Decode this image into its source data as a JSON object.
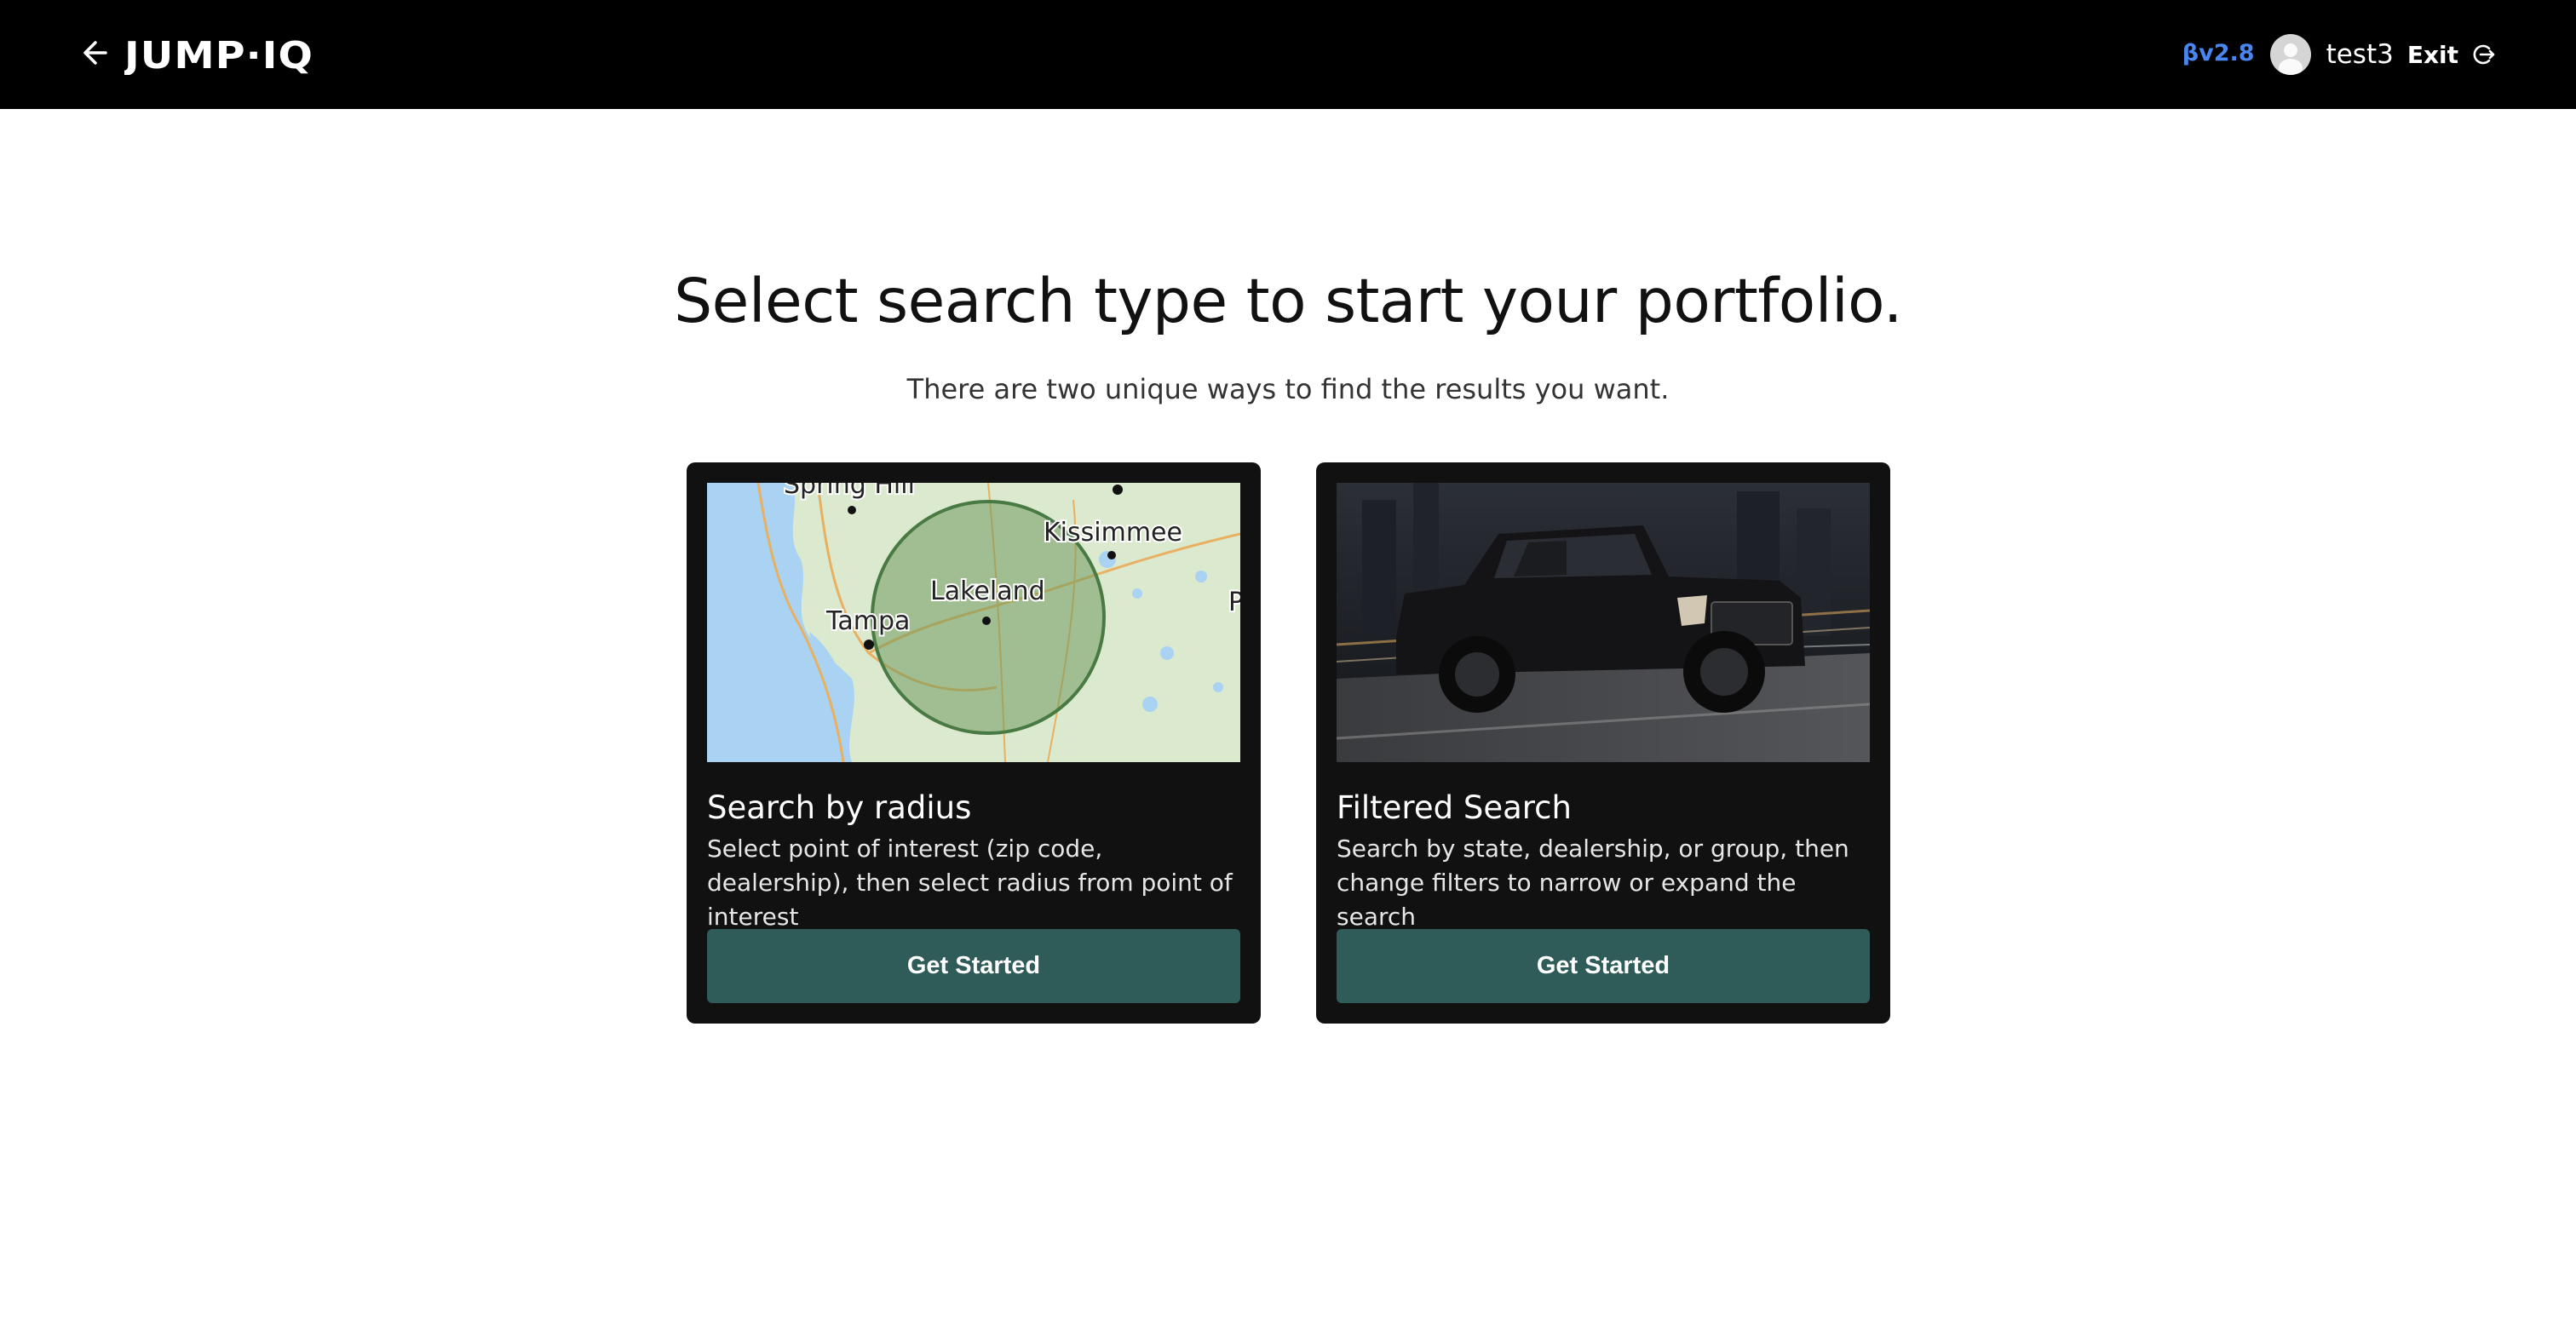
{
  "header": {
    "logo_text": "JUMP·IQ",
    "version": "βv2.8",
    "username": "test3",
    "exit_label": "Exit",
    "icons": {
      "back": "arrow-left-icon",
      "avatar": "user-avatar-icon",
      "exit": "logout-icon"
    }
  },
  "main": {
    "heading": "Select search type to start your portfolio.",
    "subheading": "There are two unique ways to find the results you want."
  },
  "cards": [
    {
      "title": "Search by radius",
      "description": "Select point of interest (zip code, dealership), then select radius from point of interest",
      "button_label": "Get Started",
      "image": "map-radius-illustration",
      "map_labels": {
        "spring_hill": "Spring Hill",
        "kissimmee": "Kissimmee",
        "lakeland": "Lakeland",
        "tampa": "Tampa",
        "edge": "P"
      }
    },
    {
      "title": "Filtered Search",
      "description": "Search by state, dealership, or group, then change filters to narrow or expand the search",
      "button_label": "Get Started",
      "image": "pickup-truck-photo"
    }
  ],
  "colors": {
    "topbar": "#000000",
    "version_accent": "#4a86f0",
    "card_bg": "#111111",
    "button_bg": "#2f5c59"
  }
}
